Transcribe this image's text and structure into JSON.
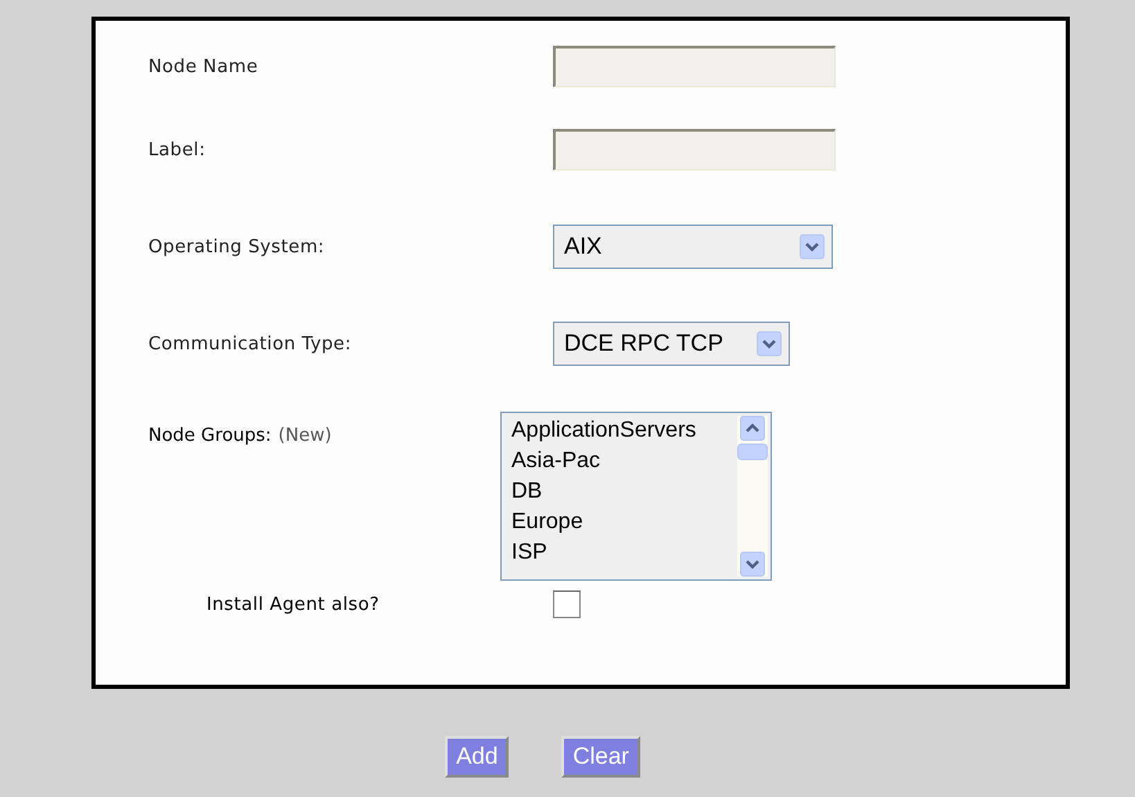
{
  "form": {
    "fields": [
      {
        "kind": "text",
        "label": "Node Name"
      },
      {
        "kind": "text",
        "label": "Label:"
      },
      {
        "kind": "select",
        "label": "Operating System:",
        "value": "AIX"
      },
      {
        "kind": "select",
        "label": "Communication Type:",
        "value": "DCE RPC TCP"
      },
      {
        "kind": "list",
        "label": "Node Groups:",
        "link": "(New)",
        "options": [
          "ApplicationServers",
          "Asia-Pac",
          "DB",
          "Europe",
          "ISP"
        ]
      },
      {
        "kind": "checkbox",
        "label": "Install Agent also?",
        "checked": false
      }
    ]
  },
  "buttons": [
    "Add",
    "Clear"
  ]
}
